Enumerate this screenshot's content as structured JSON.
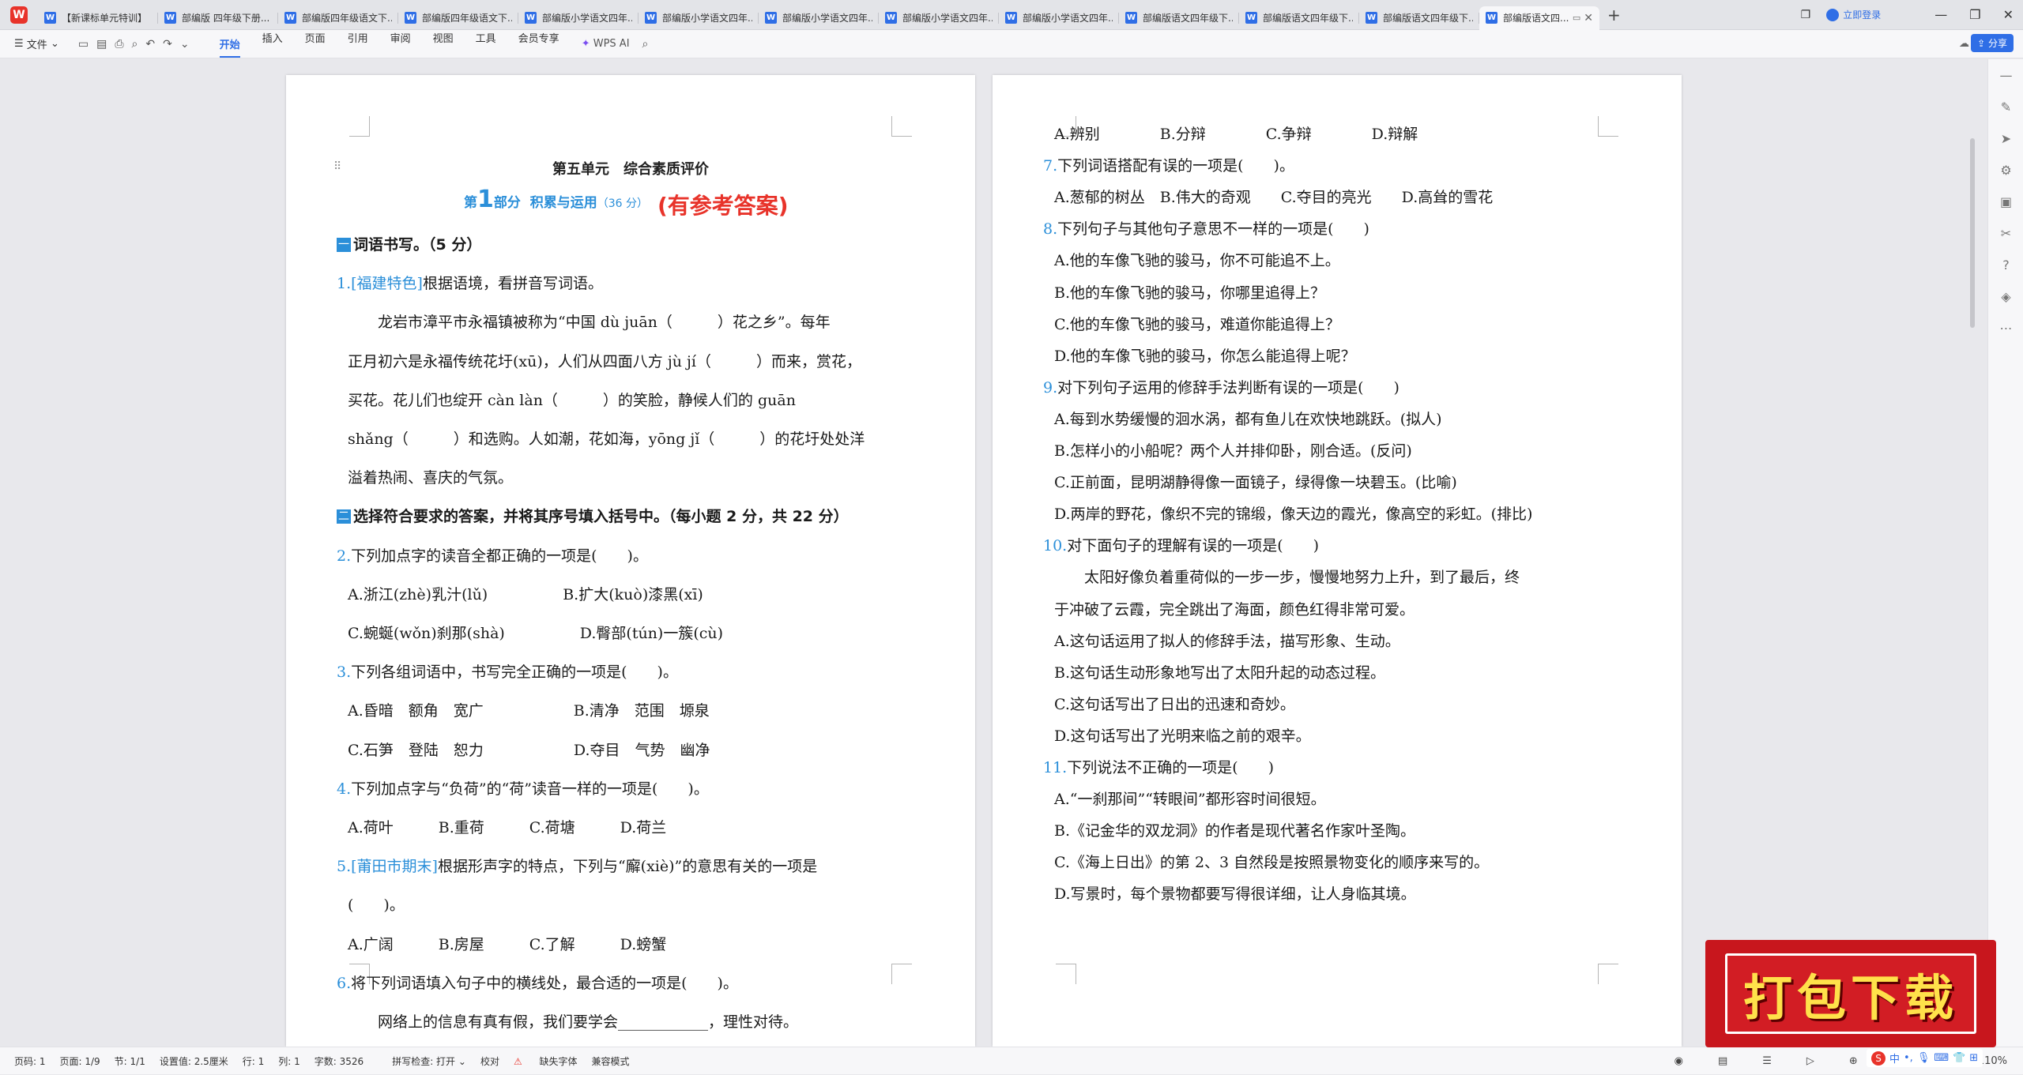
{
  "tabs": [
    {
      "label": "【新课标单元特训】"
    },
    {
      "label": "部编版 四年级下册..."
    },
    {
      "label": "部编版四年级语文下..."
    },
    {
      "label": "部编版四年级语文下..."
    },
    {
      "label": "部编版小学语文四年..."
    },
    {
      "label": "部编版小学语文四年..."
    },
    {
      "label": "部编版小学语文四年..."
    },
    {
      "label": "部编版小学语文四年..."
    },
    {
      "label": "部编版小学语文四年..."
    },
    {
      "label": "部编版语文四年级下..."
    },
    {
      "label": "部编版语文四年级下..."
    },
    {
      "label": "部编版语文四年级下..."
    },
    {
      "label": "部编版语文四..."
    }
  ],
  "login": "立即登录",
  "ribbon": {
    "file": "文件",
    "menus": [
      "开始",
      "插入",
      "页面",
      "引用",
      "审阅",
      "视图",
      "工具",
      "会员专享"
    ],
    "wps_ai": "WPS AI",
    "share": "分享"
  },
  "page1": {
    "unit_title": "第五单元　综合素质评价",
    "part_prefix": "第",
    "part_num": "1",
    "part_suffix": "部分",
    "part_name": "积累与运用",
    "part_score": "（36 分）",
    "answer_note": "(有参考答案)",
    "lines": [
      {
        "sec": "一",
        "text": "词语书写。（5 分）"
      },
      {
        "num": "1.",
        "tag": "[福建特色]",
        "text": "根据语境，看拼音写词语。"
      },
      {
        "text": "　　龙岩市漳平市永福镇被称为“中国 dù juān（　　　）花之乡”。每年"
      },
      {
        "text": "正月初六是永福传统花圩(xū)，人们从四面八方 jù jí（　　　）而来，赏花，"
      },
      {
        "text": "买花。花儿们也绽开 càn làn（　　　）的笑脸，静候人们的 guān"
      },
      {
        "text": "shǎng（　　　）和选购。人如潮，花如海，yōng jǐ（　　　）的花圩处处洋"
      },
      {
        "text": "溢着热闹、喜庆的气氛。"
      },
      {
        "sec": "二",
        "text": "选择符合要求的答案，并将其序号填入括号中。（每小题 2 分，共 22 分）"
      },
      {
        "num": "2.",
        "text": "下列加点字的读音全都正确的一项是(　　)。"
      },
      {
        "text": "A.浙江(zhè)乳汁(lǔ)　　　　　B.扩大(kuò)漆黑(xī)"
      },
      {
        "text": "C.蜿蜒(wǒn)刹那(shà)　　　　　D.臀部(tún)一簇(cù)"
      },
      {
        "num": "3.",
        "text": "下列各组词语中，书写完全正确的一项是(　　)。"
      },
      {
        "text": "A.昏暗　额角　宽广　　　　　　B.清净　范围　塬泉"
      },
      {
        "text": "C.石笋　登陆　恕力　　　　　　D.夺目　气势　幽净"
      },
      {
        "num": "4.",
        "text": "下列加点字与“负荷”的“荷”读音一样的一项是(　　)。"
      },
      {
        "text": "A.荷叶　　　B.重荷　　　C.荷塘　　　D.荷兰"
      },
      {
        "num": "5.",
        "tag": "[莆田市期末]",
        "text": "根据形声字的特点，下列与“廨(xiè)”的意思有关的一项是"
      },
      {
        "text": "(　　)。"
      },
      {
        "text": "A.广阔　　　B.房屋　　　C.了解　　　D.螃蟹"
      },
      {
        "num": "6.",
        "text": "将下列词语填入句子中的横线处，最合适的一项是(　　)。"
      },
      {
        "text": "　　网络上的信息有真有假，我们要学会____________，理性对待。"
      }
    ]
  },
  "page2": {
    "lines": [
      {
        "text": "A.辨别　　　　B.分辩　　　　C.争辩　　　　D.辩解"
      },
      {
        "num": "7.",
        "text": "下列词语搭配有误的一项是(　　)。"
      },
      {
        "text": "A.葱郁的树丛　B.伟大的奇观　　C.夺目的亮光　　D.高耸的雪花"
      },
      {
        "num": "8.",
        "text": "下列句子与其他句子意思不一样的一项是(　　)"
      },
      {
        "text": "A.他的车像飞驰的骏马，你不可能追不上。"
      },
      {
        "text": "B.他的车像飞驰的骏马，你哪里追得上？"
      },
      {
        "text": "C.他的车像飞驰的骏马，难道你能追得上？"
      },
      {
        "text": "D.他的车像飞驰的骏马，你怎么能追得上呢？"
      },
      {
        "num": "9.",
        "text": "对下列句子运用的修辞手法判断有误的一项是(　　)"
      },
      {
        "text": "A.每到水势缓慢的洄水涡，都有鱼儿在欢快地跳跃。(拟人)"
      },
      {
        "text": "B.怎样小的小船呢？两个人并排仰卧，刚合适。(反问)"
      },
      {
        "text": "C.正前面，昆明湖静得像一面镜子，绿得像一块碧玉。(比喻)"
      },
      {
        "text": "D.两岸的野花，像织不完的锦缎，像天边的霞光，像高空的彩虹。(排比)"
      },
      {
        "num": "10.",
        "text": "对下面句子的理解有误的一项是(　　)"
      },
      {
        "text": "　　太阳好像负着重荷似的一步一步，慢慢地努力上升，到了最后，终"
      },
      {
        "text": "于冲破了云霞，完全跳出了海面，颜色红得非常可爱。"
      },
      {
        "text": "A.这句话运用了拟人的修辞手法，描写形象、生动。"
      },
      {
        "text": "B.这句话生动形象地写出了太阳升起的动态过程。"
      },
      {
        "text": "C.这句话写出了日出的迅速和奇妙。"
      },
      {
        "text": "D.这句话写出了光明来临之前的艰辛。"
      },
      {
        "num": "11.",
        "text": "下列说法不正确的一项是(　　)"
      },
      {
        "text": "A.“一刹那间”“转眼间”都形容时间很短。"
      },
      {
        "text": "B.《记金华的双龙洞》的作者是现代著名作家叶圣陶。"
      },
      {
        "text": "C.《海上日出》的第 2、3 自然段是按照景物变化的顺序来写的。"
      },
      {
        "text": "D.写景时，每个景物都要写得很详细，让人身临其境。"
      }
    ]
  },
  "status": {
    "page": "页码: 1",
    "pages": "页面: 1/9",
    "section": "节: 1/1",
    "setting": "设置值: 2.5厘米",
    "row": "行: 1",
    "col": "列: 1",
    "words": "字数: 3526",
    "spell": "拼写检查: 打开",
    "proof": "校对",
    "missing_font": "缺失字体",
    "compat": "兼容模式",
    "zoom": "110%"
  },
  "banner": {
    "text": "打包下载"
  },
  "colors": {
    "accent": "#2f6ee6",
    "exam_blue": "#2b8fd9",
    "red": "#e8332a"
  }
}
